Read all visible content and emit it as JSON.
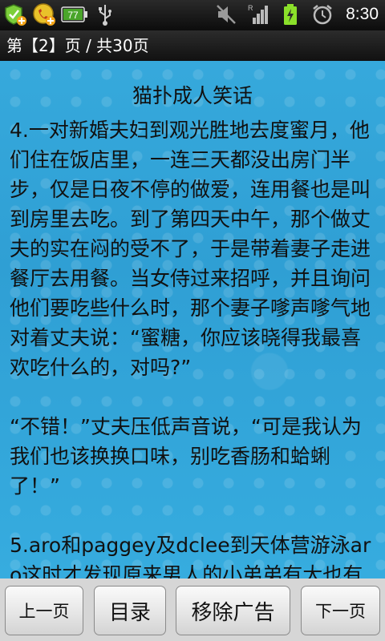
{
  "status_bar": {
    "left_icons": [
      "shield-plus-icon",
      "phone-plus-icon",
      "battery-level-icon",
      "usb-icon"
    ],
    "battery_badge": "77",
    "right_icons": [
      "mute-icon",
      "signal-icon",
      "battery-charging-icon",
      "alarm-icon"
    ],
    "signal_label": "R",
    "time": "8:30"
  },
  "page_header": {
    "label": "第【2】页 / 共30页"
  },
  "content": {
    "title": "猫扑成人笑话",
    "text": "4.一对新婚夫妇到观光胜地去度蜜月，他们住在饭店里，一连三天都没出房门半步，仅是日夜不停的做爱，连用餐也是叫到房里去吃。到了第四天中午，那个做丈夫的实在闷的受不了，于是带着妻子走进餐厅去用餐。当女侍过来招呼，并且询问他们要吃些什么时，那个妻子嗲声嗲气地对着丈夫说：“蜜糖，你应该晓得我最喜欢吃什么的，对吗?”\n\n“不错！”丈夫压低声音说，“可是我认为我们也该换换口味，别吃香肠和蛤蜊了！”\n\n5.aro和paggey及dclee到天体营游泳aro这时才发现原来男人的小弟弟有大也有小。aro 很好奇问dclee为什麼?"
  },
  "bottom_bar": {
    "prev_label": "上一页",
    "toc_label": "目录",
    "remove_ads_label": "移除广告",
    "next_label": "下一页"
  },
  "colors": {
    "content_bg": "#33a6dc",
    "bar_bg": "#1a1a1a",
    "bottom_bg": "#d6d6d6"
  }
}
